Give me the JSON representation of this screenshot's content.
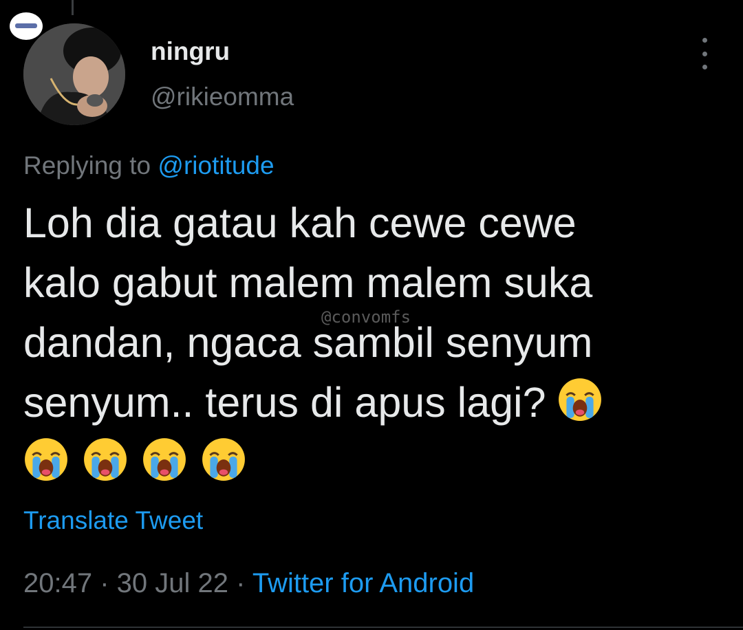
{
  "tweet": {
    "display_name": "ningru",
    "handle": "@rikieomma",
    "replying_prefix": "Replying to ",
    "replying_to": "@riotitude",
    "text_lines": [
      "Loh dia gatau kah cewe cewe",
      "kalo gabut malem malem suka",
      "dandan, ngaca sambil senyum",
      "senyum.. terus di apus lagi?"
    ],
    "emoji": "loudly-crying-face",
    "translate_label": "Translate Tweet",
    "time": "20:47",
    "date": "30 Jul 22",
    "separator": " · ",
    "source": "Twitter for Android"
  },
  "watermark": "@convomfs",
  "colors": {
    "background": "#000000",
    "text": "#e7e9ea",
    "muted": "#71767b",
    "link": "#1d9bf0"
  }
}
